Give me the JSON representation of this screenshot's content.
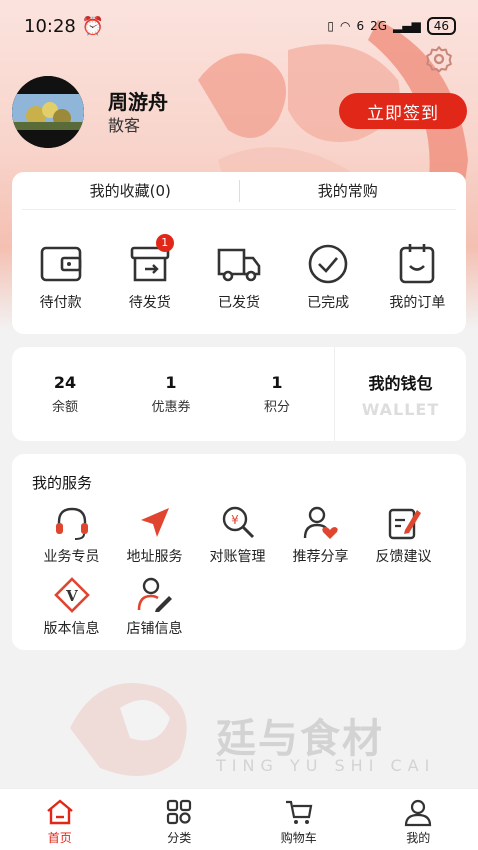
{
  "status": {
    "time": "10:28",
    "signal_label": "6",
    "network": "2G",
    "battery": "46"
  },
  "profile": {
    "name": "周游舟",
    "type": "散客",
    "signin_label": "立即签到"
  },
  "favorites": {
    "collection": "我的收藏(0)",
    "frequent": "我的常购"
  },
  "orders": [
    {
      "label": "待付款",
      "icon": "wallet-icon"
    },
    {
      "label": "待发货",
      "icon": "box-icon",
      "badge": "1"
    },
    {
      "label": "已发货",
      "icon": "truck-icon"
    },
    {
      "label": "已完成",
      "icon": "check-circle-icon"
    },
    {
      "label": "我的订单",
      "icon": "clipboard-icon"
    }
  ],
  "stats": [
    {
      "value": "24",
      "label": "余额"
    },
    {
      "value": "1",
      "label": "优惠券"
    },
    {
      "value": "1",
      "label": "积分"
    }
  ],
  "wallet": {
    "title": "我的钱包",
    "subtitle": "WALLET"
  },
  "services": {
    "title": "我的服务",
    "items": [
      {
        "label": "业务专员",
        "icon": "headset-icon"
      },
      {
        "label": "地址服务",
        "icon": "location-arrow-icon"
      },
      {
        "label": "对账管理",
        "icon": "search-yuan-icon"
      },
      {
        "label": "推荐分享",
        "icon": "user-heart-icon"
      },
      {
        "label": "反馈建议",
        "icon": "edit-note-icon"
      },
      {
        "label": "版本信息",
        "icon": "version-icon"
      },
      {
        "label": "店铺信息",
        "icon": "user-edit-icon"
      }
    ]
  },
  "watermark": {
    "cn": "廷与食材",
    "en": "TING YU SHI CAI"
  },
  "tabs": [
    {
      "label": "首页",
      "icon": "home-icon",
      "active": true
    },
    {
      "label": "分类",
      "icon": "category-icon"
    },
    {
      "label": "购物车",
      "icon": "cart-icon"
    },
    {
      "label": "我的",
      "icon": "profile-icon"
    }
  ],
  "colors": {
    "accent": "#e02718",
    "icon_red": "#e0452f"
  }
}
